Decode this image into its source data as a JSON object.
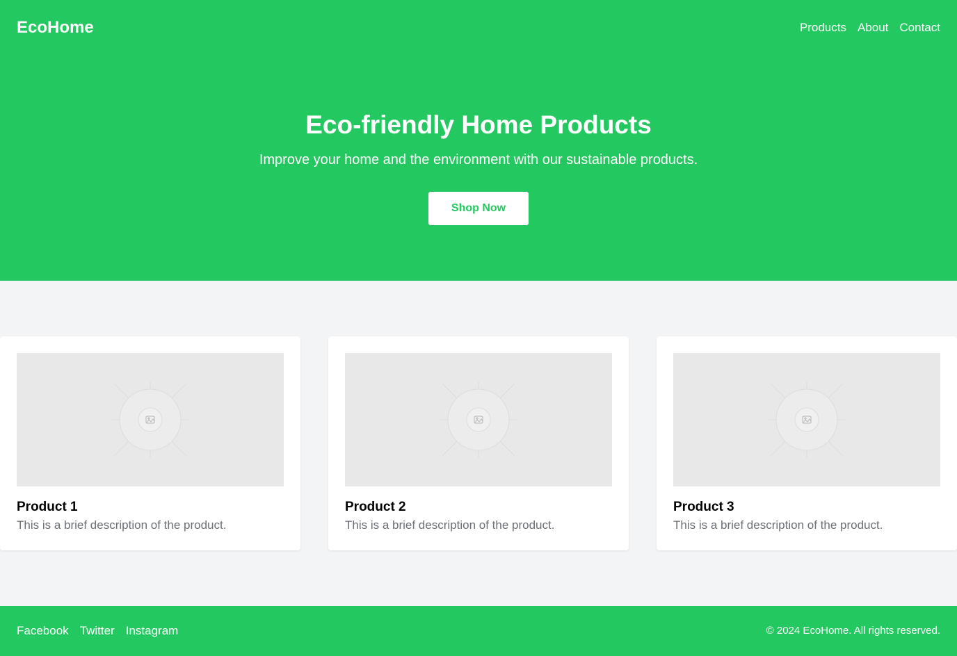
{
  "header": {
    "brand": "EcoHome",
    "nav": [
      "Products",
      "About",
      "Contact"
    ]
  },
  "hero": {
    "title": "Eco-friendly Home Products",
    "subtitle": "Improve your home and the environment with our sustainable products.",
    "cta_label": "Shop Now"
  },
  "products": [
    {
      "title": "Product 1",
      "description": "This is a brief description of the product.",
      "image_icon": "image-placeholder-icon"
    },
    {
      "title": "Product 2",
      "description": "This is a brief description of the product.",
      "image_icon": "image-placeholder-icon"
    },
    {
      "title": "Product 3",
      "description": "This is a brief description of the product.",
      "image_icon": "image-placeholder-icon"
    }
  ],
  "footer": {
    "links": [
      "Facebook",
      "Twitter",
      "Instagram"
    ],
    "copyright": "© 2024 EcoHome. All rights reserved."
  },
  "colors": {
    "accent": "#24c860",
    "page_background": "#f2f4f6",
    "card_background": "#ffffff",
    "placeholder": "#e8e8e8",
    "muted_text": "#6b6f76"
  }
}
